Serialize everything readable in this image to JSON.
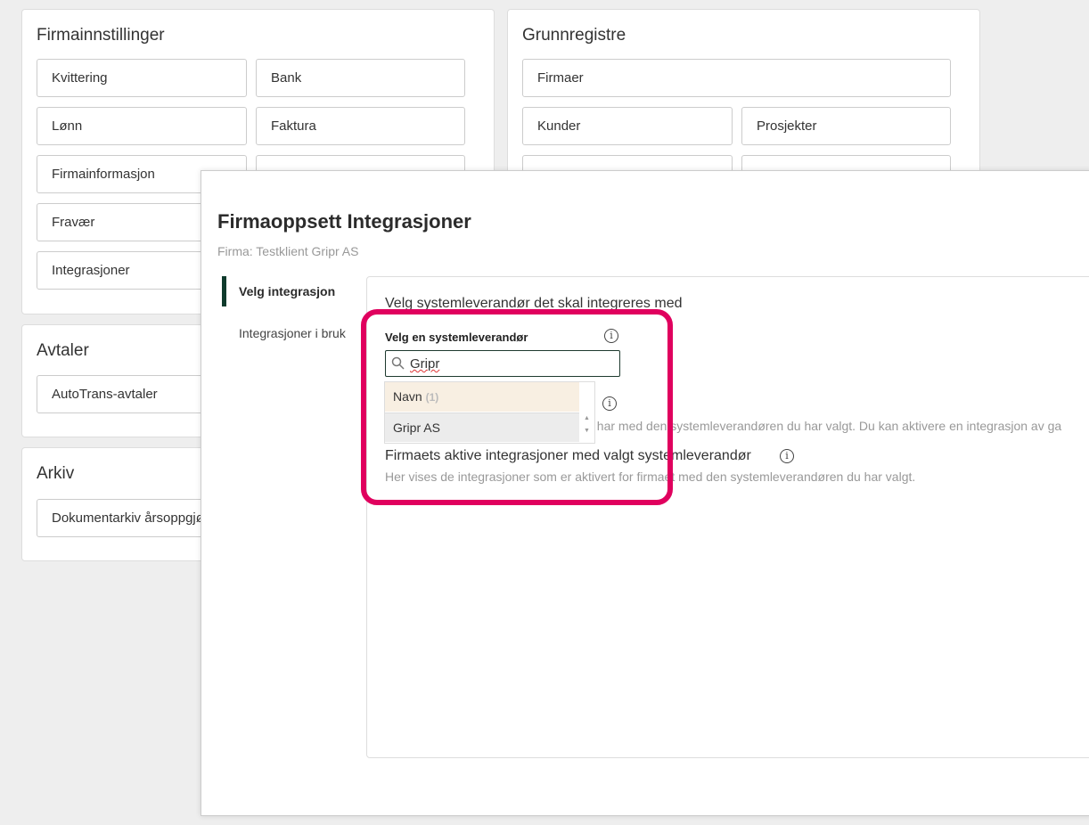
{
  "firmainnstillinger": {
    "title": "Firmainnstillinger",
    "buttons": [
      "Kvittering",
      "Bank",
      "Lønn",
      "Faktura",
      "Firmainformasjon",
      "",
      "Fravær",
      "",
      "Integrasjoner",
      ""
    ]
  },
  "grunnregistre": {
    "title": "Grunnregistre",
    "buttons": [
      "Firmaer",
      "Kunder",
      "Prosjekter"
    ]
  },
  "avtaler": {
    "title": "Avtaler",
    "buttons": [
      "AutoTrans-avtaler"
    ]
  },
  "arkiv": {
    "title": "Arkiv",
    "buttons": [
      "Dokumentarkiv årsoppgjør"
    ]
  },
  "modal": {
    "title": "Firmaoppsett Integrasjoner",
    "subtitle": "Firma: Testklient Gripr AS",
    "nav": [
      "Velg integrasjon",
      "Integrasjoner i bruk"
    ],
    "heading": "Velg systemleverandør det skal integreres med",
    "field_label": "Velg en systemleverandør",
    "search_value": "Gripr",
    "dropdown": {
      "header": "Navn",
      "count": "(1)",
      "items": [
        "Gripr AS"
      ]
    },
    "hidden_desc": "t har med den systemleverandøren du har valgt. Du kan aktivere en integrasjon av ga",
    "active_heading": "Firmaets aktive integrasjoner med valgt systemleverandør",
    "active_desc": "Her vises de integrasjoner som er aktivert for firmaet med den systemleverandøren du har valgt.",
    "info_glyph": "i"
  },
  "colors": {
    "highlight": "#e0005e",
    "accent": "#0f3b2c"
  }
}
